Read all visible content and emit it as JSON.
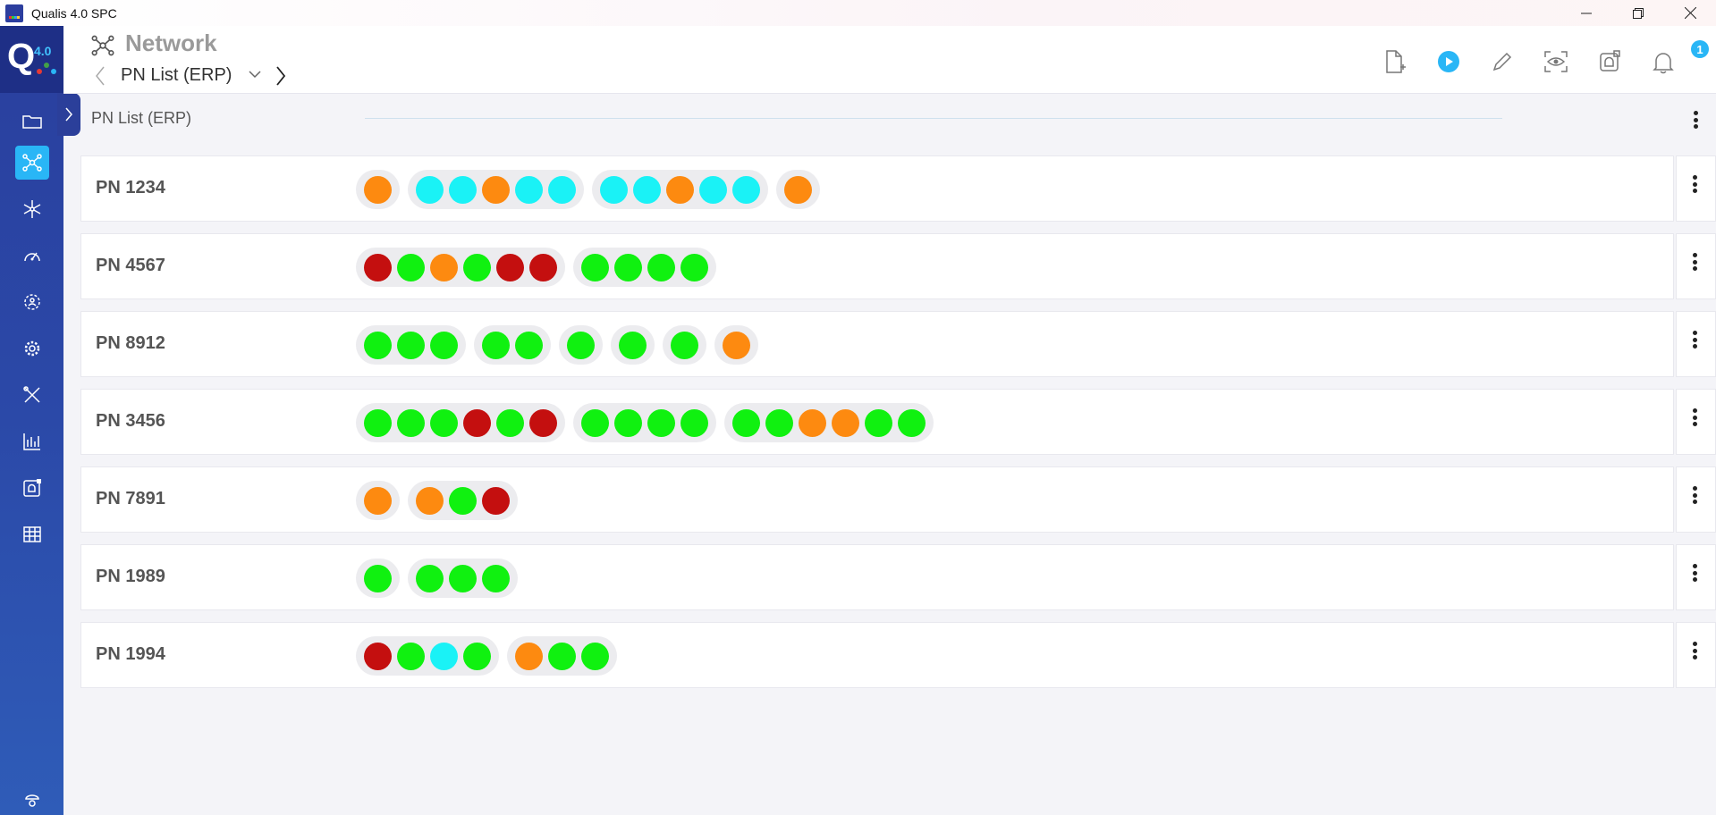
{
  "window": {
    "title": "Qualis 4.0 SPC"
  },
  "logo": {
    "letter": "Q",
    "version": "4.0"
  },
  "header": {
    "title": "Network",
    "breadcrumb": "PN List (ERP)",
    "notification_count": "1"
  },
  "section": {
    "title": "PN List (ERP)"
  },
  "colors": {
    "green": "#10f110",
    "red": "#c40f0f",
    "orange": "#fd8a10",
    "cyan": "#1af2f6",
    "accent": "#29b6f6",
    "sidebar": "#2a3f9e"
  },
  "rows": [
    {
      "pn": "PN 1234",
      "groups": [
        [
          "orange"
        ],
        [
          "cyan",
          "cyan",
          "orange",
          "cyan",
          "cyan"
        ],
        [
          "cyan",
          "cyan",
          "orange",
          "cyan",
          "cyan"
        ],
        [
          "orange"
        ]
      ]
    },
    {
      "pn": "PN 4567",
      "groups": [
        [
          "red",
          "green",
          "orange",
          "green",
          "red",
          "red"
        ],
        [
          "green",
          "green",
          "green",
          "green"
        ]
      ]
    },
    {
      "pn": "PN 8912",
      "groups": [
        [
          "green",
          "green",
          "green"
        ],
        [
          "green",
          "green"
        ],
        [
          "green"
        ],
        [
          "green"
        ],
        [
          "green"
        ],
        [
          "orange"
        ]
      ]
    },
    {
      "pn": "PN 3456",
      "groups": [
        [
          "green",
          "green",
          "green",
          "red",
          "green",
          "red"
        ],
        [
          "green",
          "green",
          "green",
          "green"
        ],
        [
          "green",
          "green",
          "orange",
          "orange",
          "green",
          "green"
        ]
      ]
    },
    {
      "pn": "PN 7891",
      "groups": [
        [
          "orange"
        ],
        [
          "orange",
          "green",
          "red"
        ]
      ]
    },
    {
      "pn": "PN 1989",
      "groups": [
        [
          "green"
        ],
        [
          "green",
          "green",
          "green"
        ]
      ]
    },
    {
      "pn": "PN 1994",
      "groups": [
        [
          "red",
          "green",
          "cyan",
          "green"
        ],
        [
          "orange",
          "green",
          "green"
        ]
      ]
    }
  ]
}
